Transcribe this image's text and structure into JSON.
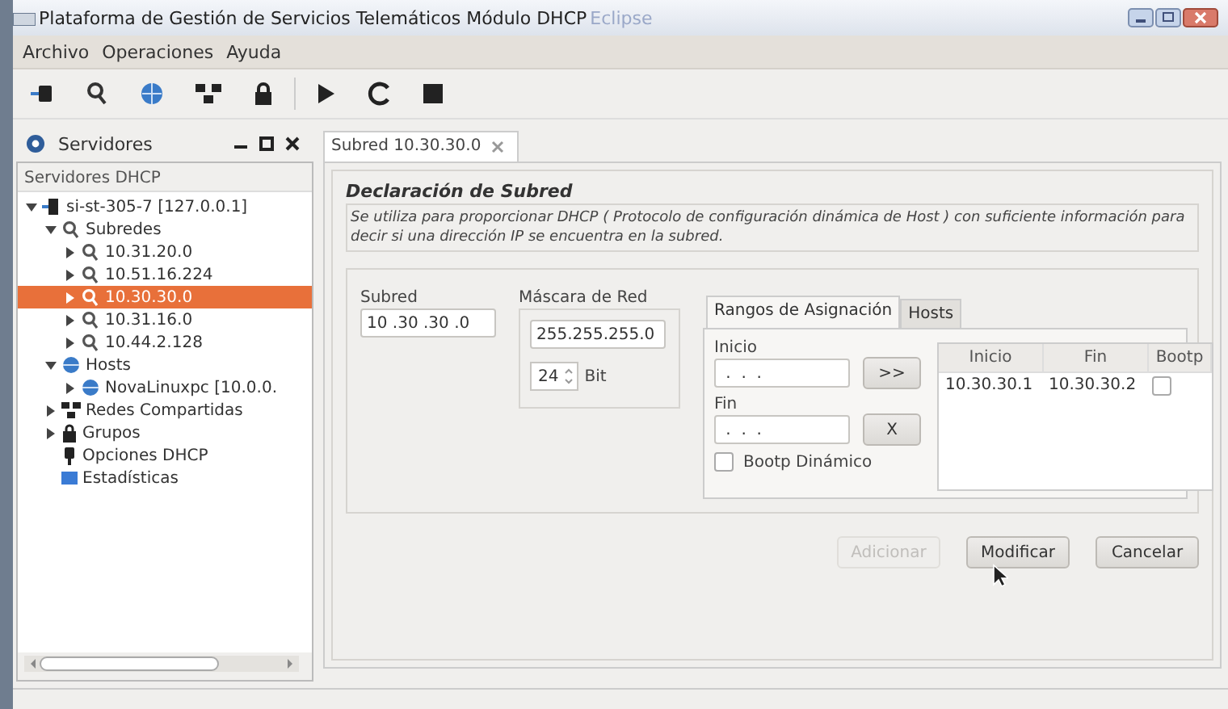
{
  "window": {
    "title": "Plataforma de Gestión de Servicios Telemáticos Módulo DHCP",
    "subtitle": "Eclipse"
  },
  "menu": [
    "Archivo",
    "Operaciones",
    "Ayuda"
  ],
  "servers_view": {
    "title": "Servidores",
    "heading": "Servidores DHCP",
    "tree": [
      {
        "label": "si-st-305-7 [127.0.0.1]",
        "kind": "server",
        "expanded": true,
        "selected": false,
        "children": [
          {
            "label": "Subredes",
            "kind": "subnet",
            "expanded": true,
            "selected": false,
            "children": [
              {
                "label": "10.31.20.0",
                "kind": "subnet",
                "expanded": false,
                "selected": false
              },
              {
                "label": "10.51.16.224",
                "kind": "subnet",
                "expanded": false,
                "selected": false
              },
              {
                "label": "10.30.30.0",
                "kind": "subnet",
                "expanded": false,
                "selected": true
              },
              {
                "label": "10.31.16.0",
                "kind": "subnet",
                "expanded": false,
                "selected": false
              },
              {
                "label": "10.44.2.128",
                "kind": "subnet",
                "expanded": false,
                "selected": false
              }
            ]
          },
          {
            "label": "Hosts",
            "kind": "host",
            "expanded": true,
            "selected": false,
            "children": [
              {
                "label": "NovaLinuxpc [10.0.0.",
                "kind": "host",
                "expanded": false,
                "selected": false
              }
            ]
          },
          {
            "label": "Redes Compartidas",
            "kind": "shared",
            "expanded": false,
            "selected": false
          },
          {
            "label": "Grupos",
            "kind": "group",
            "expanded": false,
            "selected": false
          },
          {
            "label": "Opciones DHCP",
            "kind": "options",
            "selected": false
          },
          {
            "label": "Estadísticas",
            "kind": "stats",
            "selected": false
          }
        ]
      }
    ]
  },
  "editor": {
    "tab": "Subred 10.30.30.0",
    "section_title": "Declaración de Subred",
    "description": "Se utiliza para proporcionar DHCP ( Protocolo de configuración dinámica de Host ) con suficiente información  para decir si  una dirección IP se encuentra en la subred.",
    "subnet": {
      "label": "Subred",
      "value": "10 .30 .30 .0"
    },
    "mask": {
      "label": "Máscara de Red",
      "value": "255.255.255.0",
      "bits": "24",
      "bits_unit": "Bit"
    },
    "tabs": [
      {
        "label": "Rangos de Asignación",
        "selected": true
      },
      {
        "label": "Hosts",
        "selected": false
      }
    ],
    "range_start": {
      "label": "Inicio",
      "value": " .  .  ."
    },
    "range_end": {
      "label": "Fin",
      "value": " .  .  ."
    },
    "add_range_button": ">>",
    "remove_range_button": "X",
    "dynamic_bootp": {
      "label": "Bootp Dinámico",
      "checked": false
    },
    "ranges": {
      "columns": [
        "Inicio",
        "Fin",
        "Bootp"
      ],
      "rows": [
        {
          "start": "10.30.30.1",
          "end": "10.30.30.2",
          "bootp": false
        }
      ]
    },
    "buttons": [
      {
        "label": "Adicionar",
        "disabled": true
      },
      {
        "label": "Modificar",
        "disabled": false
      },
      {
        "label": "Cancelar",
        "disabled": false
      }
    ]
  }
}
